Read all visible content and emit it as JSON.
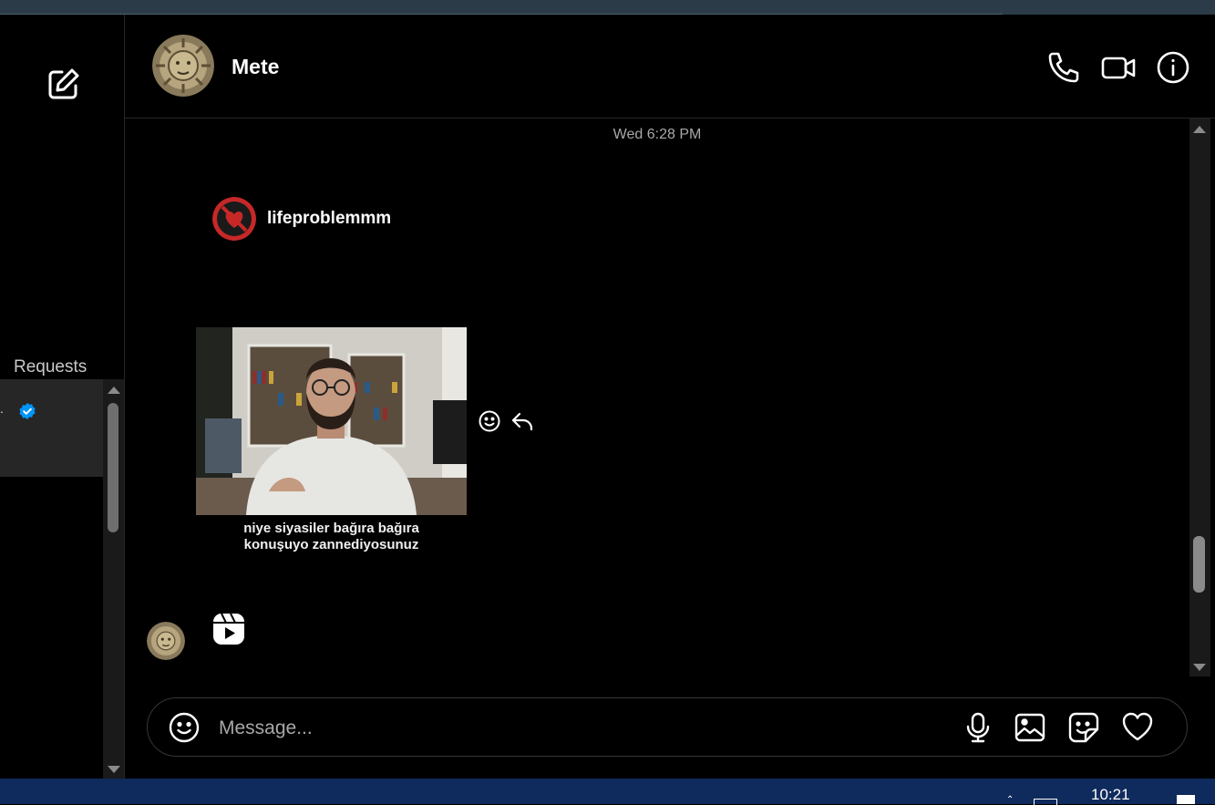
{
  "app": {
    "theme": "dark",
    "accent_color": "#0095f6"
  },
  "sidebar": {
    "compose_icon": "pencil-square-icon",
    "requests_label": "Requests",
    "conversation": {
      "name_fragment": ".",
      "verified": true
    }
  },
  "header": {
    "contact_name": "Mete",
    "actions": [
      "phone-icon",
      "video-camera-icon",
      "info-icon"
    ]
  },
  "messages": {
    "timestamp": "Wed 6:28 PM",
    "shared_post": {
      "username": "lifeproblemmm",
      "caption_line1": "niye siyasiler bağıra bağıra",
      "caption_line2": "konuşuyo zannediyosunuz"
    },
    "reply": {
      "type": "reel",
      "icon": "reels-icon"
    }
  },
  "composer": {
    "placeholder": "Message...",
    "actions": [
      "microphone-icon",
      "image-icon",
      "sticker-icon",
      "heart-icon"
    ]
  },
  "taskbar": {
    "time": "10:21"
  }
}
